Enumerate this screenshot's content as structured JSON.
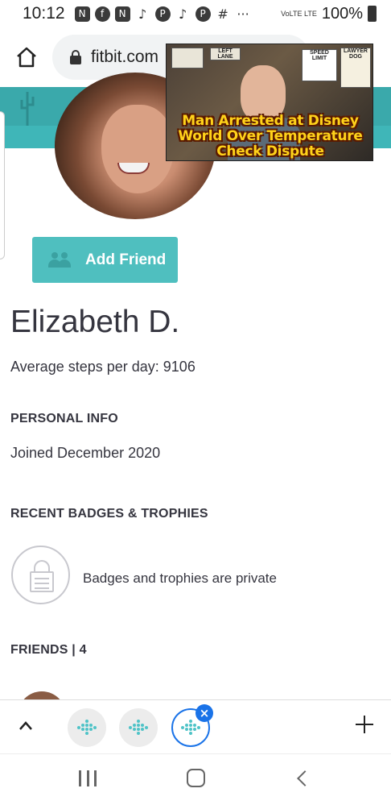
{
  "status_bar": {
    "time": "10:12",
    "battery": "100%",
    "network": "VoLTE LTE",
    "notification_icons": [
      "n-icon",
      "facebook-icon",
      "n-icon",
      "tiktok-icon",
      "pinterest-icon",
      "tiktok-icon",
      "pinterest-icon",
      "grid-icon",
      "more-icon"
    ]
  },
  "browser": {
    "url": "fitbit.com"
  },
  "video": {
    "caption": "Man Arrested at Disney World Over Temperature Check Dispute",
    "signs": [
      "LEFT LANE",
      "SPEED LIMIT",
      "LAWYER DOG"
    ]
  },
  "profile": {
    "add_friend_label": "Add Friend",
    "name": "Elizabeth D.",
    "average_steps": "Average steps per day: 9106",
    "personal_info_heading": "PERSONAL INFO",
    "joined": "Joined December 2020",
    "badges_heading": "RECENT BADGES & TROPHIES",
    "badges_private": "Badges and trophies are private",
    "friends_heading": "FRIENDS | 4"
  },
  "tab_bar": {
    "close_symbol": "×"
  },
  "colors": {
    "teal": "#4fbfbf",
    "banner": "#3fb6b8",
    "active_tab": "#1a73e8",
    "text": "#35353f"
  }
}
